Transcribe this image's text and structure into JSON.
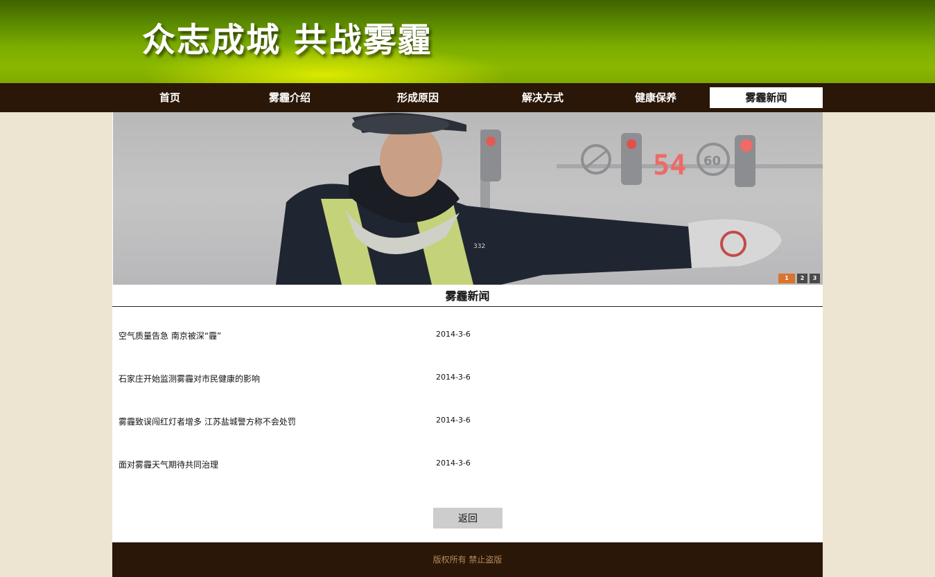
{
  "header": {
    "title": "众志成城  共战雾霾"
  },
  "nav": {
    "items": [
      {
        "label": "首页"
      },
      {
        "label": "雾霾介绍"
      },
      {
        "label": "形成原因"
      },
      {
        "label": "解决方式"
      },
      {
        "label": "健康保养"
      },
      {
        "label": "雾霾新闻"
      }
    ],
    "active": "雾霾新闻"
  },
  "banner": {
    "signal_countdown": "54",
    "speed_limit": "60",
    "badge_number": "332",
    "pager": [
      "1",
      "2",
      "3"
    ],
    "pager_active": "1"
  },
  "news": {
    "section_title": "雾霾新闻",
    "items": [
      {
        "title": "空气质量告急 南京被深“霾”",
        "date": "2014-3-6"
      },
      {
        "title": "石家庄开始监测雾霾对市民健康的影响",
        "date": "2014-3-6"
      },
      {
        "title": "雾霾致误闯红灯者增多 江苏盐城警方称不会处罚",
        "date": "2014-3-6"
      },
      {
        "title": "面对雾霾天气期待共同治理",
        "date": "2014-3-6"
      }
    ],
    "back_label": "返回"
  },
  "footer": {
    "copyright": "版权所有 禁止盗版"
  },
  "colors": {
    "nav_bg": "#2a1707",
    "page_bg": "#ede4d2",
    "header_green": "#7aab00",
    "footer_text": "#b58c5c",
    "pager_active": "#d9742c"
  }
}
